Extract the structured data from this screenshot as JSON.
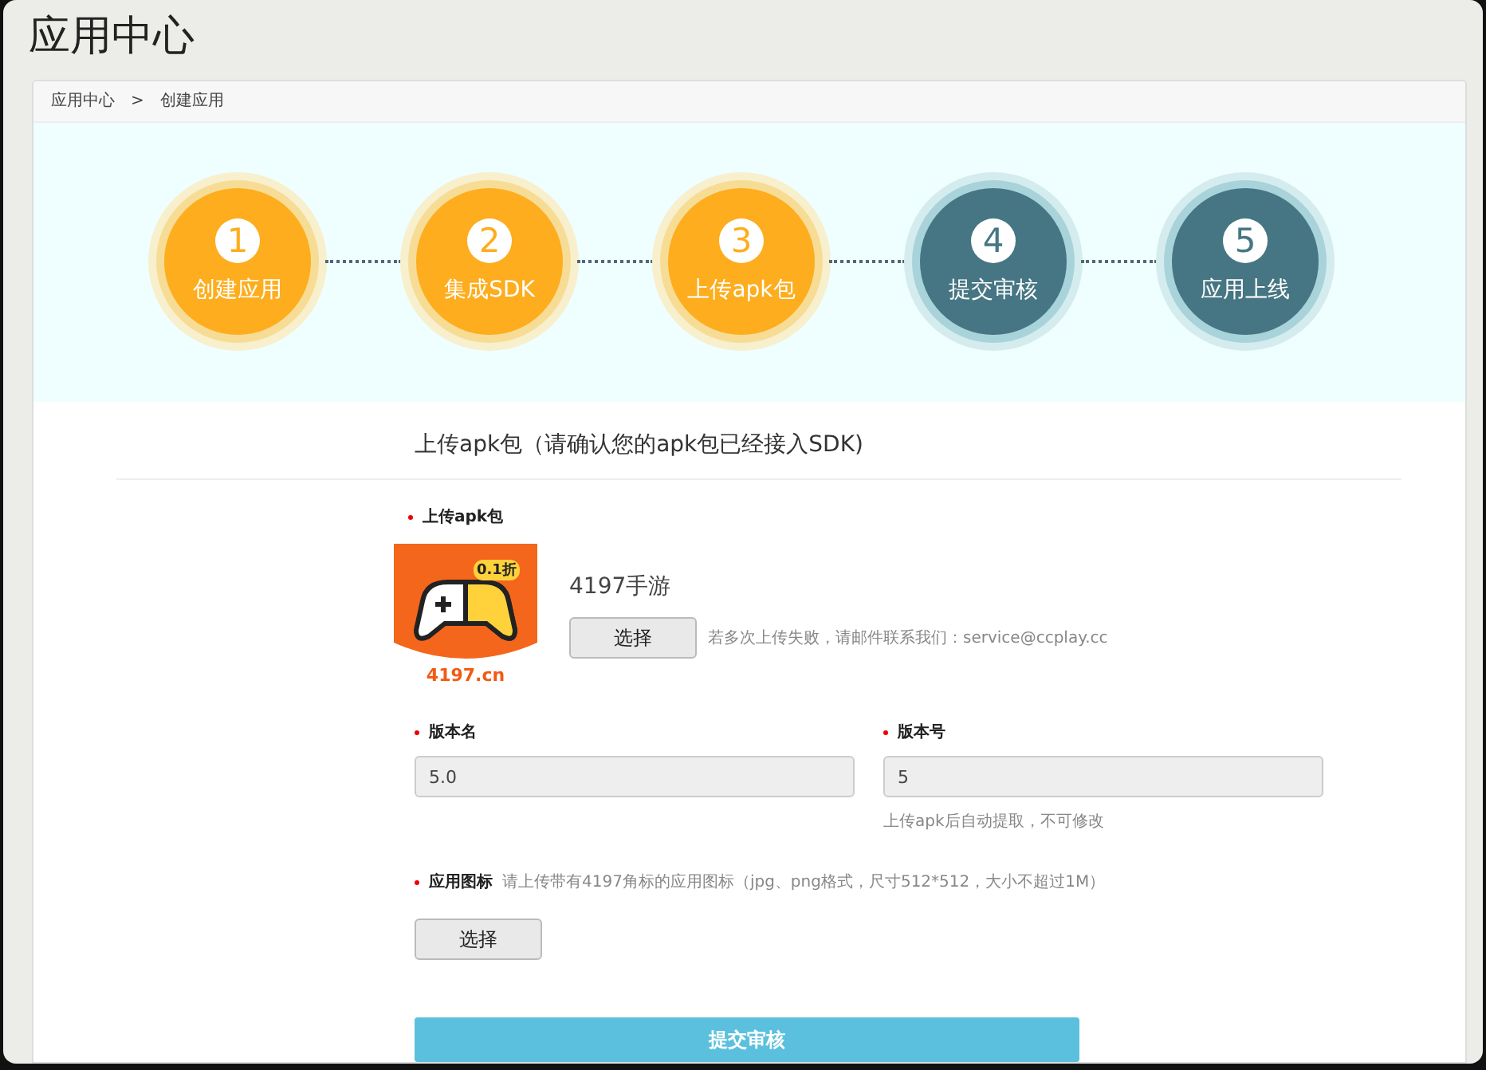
{
  "page_title": "应用中心",
  "breadcrumb": [
    {
      "label": "应用中心"
    },
    {
      "label": ">"
    },
    {
      "label": "创建应用"
    }
  ],
  "steps": [
    {
      "number": "1",
      "label": "创建应用",
      "done": true
    },
    {
      "number": "2",
      "label": "集成SDK",
      "done": true
    },
    {
      "number": "3",
      "label": "上传apk包",
      "done": true
    },
    {
      "number": "4",
      "label": "提交审核",
      "done": false
    },
    {
      "number": "5",
      "label": "应用上线",
      "done": false
    }
  ],
  "section_title": "上传apk包（请确认您的apk包已经接入SDK)",
  "upload": {
    "label": "上传apk包",
    "required": true,
    "icon_badge": "0.1折",
    "icon_caption": "4197.cn",
    "app_name": "4197手游",
    "button": "选择",
    "hint": "若多次上传失败，请邮件联系我们：service@ccplay.cc"
  },
  "version_name": {
    "label": "版本名",
    "required": true,
    "value": "5.0"
  },
  "version_code": {
    "label": "版本号",
    "required": true,
    "value": "5",
    "hint": "上传apk后自动提取，不可修改"
  },
  "app_icon": {
    "label": "应用图标",
    "required": true,
    "hint": "请上传带有4197角标的应用图标（jpg、png格式，尺寸512*512，大小不超过1M）",
    "button": "选择"
  },
  "submit": "提交审核"
}
